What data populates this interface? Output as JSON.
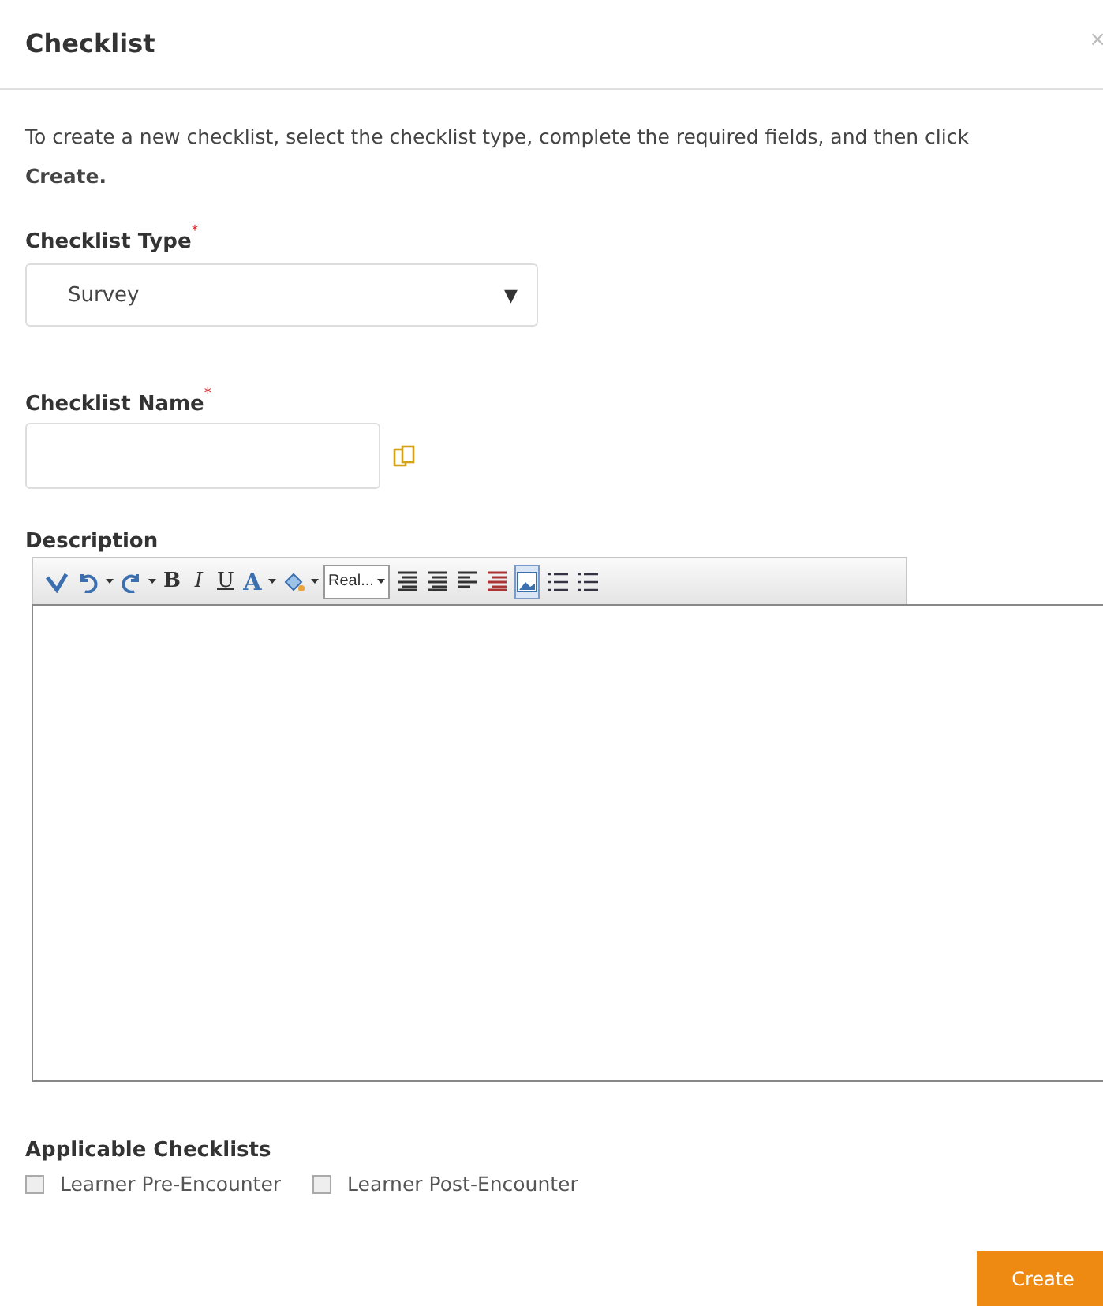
{
  "dialog": {
    "title": "Checklist",
    "close": "×"
  },
  "intro": "To create a new checklist, select the checklist type, complete the required fields, and then click **Create.**",
  "type_field": {
    "label": "Checklist Type",
    "required": "*",
    "value": "Survey",
    "caret": "▼"
  },
  "name_field": {
    "label": "Checklist Name",
    "required": "*"
  },
  "description": {
    "label": "Description",
    "toolbar": [
      {
        "kind": "spell"
      },
      {
        "kind": "undo"
      },
      {
        "kind": "drop"
      },
      {
        "kind": "redo"
      },
      {
        "kind": "drop"
      },
      {
        "kind": "bold",
        "text": "B"
      },
      {
        "kind": "italic",
        "text": "I"
      },
      {
        "kind": "underline",
        "text": "U"
      },
      {
        "kind": "color",
        "text": "A"
      },
      {
        "kind": "drop"
      },
      {
        "kind": "fill"
      },
      {
        "kind": "drop"
      },
      {
        "kind": "select",
        "text": "Real..."
      },
      {
        "kind": "indent"
      },
      {
        "kind": "outdent"
      },
      {
        "kind": "align"
      },
      {
        "kind": "justify"
      },
      {
        "kind": "image",
        "selected": true
      },
      {
        "kind": "ordered"
      },
      {
        "kind": "bullets"
      }
    ]
  },
  "applicable": {
    "label": "Applicable Checklists",
    "options": [
      {
        "label": "Learner Pre-Encounter",
        "checked": false
      },
      {
        "label": "Learner Post-Encounter",
        "checked": false
      }
    ]
  },
  "create_button": "Create"
}
